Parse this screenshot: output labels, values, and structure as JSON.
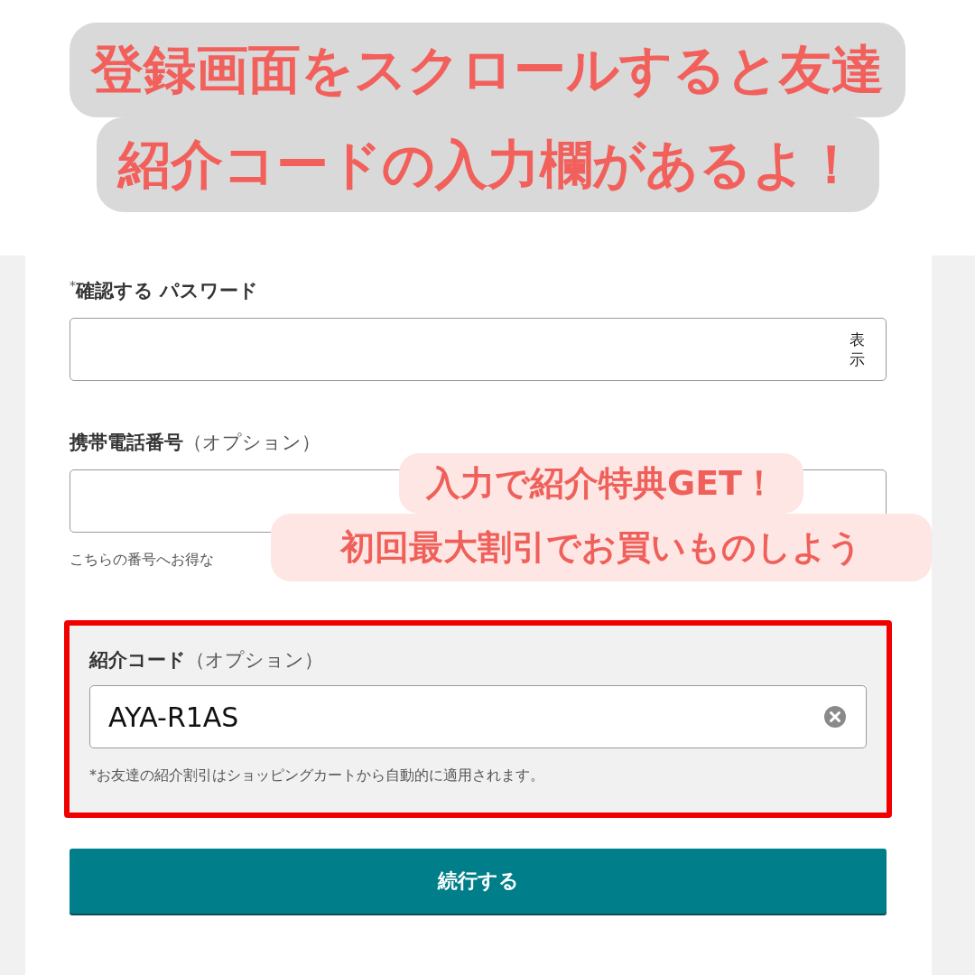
{
  "headline": [
    "登録画面をスクロールすると友達",
    "紹介コードの入力欄があるよ！"
  ],
  "form": {
    "fields": [
      {
        "kind": "password",
        "required_mark": "*",
        "label": "確認する パスワード",
        "toggle": "表示"
      },
      {
        "kind": "phone",
        "label": "携帯電話番号",
        "optional": "（オプション）",
        "hint": "こちらの番号へお得な"
      }
    ],
    "referral": {
      "label": "紹介コード",
      "optional": "（オプション）",
      "value": "AYA-R1AS",
      "note": "*お友達の紹介割引はショッピングカートから自動的に適用されます。",
      "highlighted": true
    },
    "continue_button": "続行する"
  },
  "callout": [
    "入力で紹介特典GET！",
    "初回最大割引でお買いものしよう"
  ]
}
